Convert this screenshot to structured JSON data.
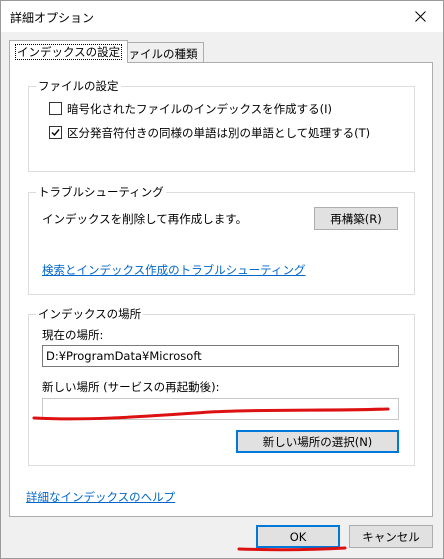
{
  "window": {
    "title": "詳細オプション"
  },
  "tabs": [
    {
      "label": "インデックスの設定"
    },
    {
      "label": "ファイルの種類"
    }
  ],
  "file_settings": {
    "label": "ファイルの設定",
    "option_encrypted": {
      "label": "暗号化されたファイルのインデックスを作成する(I)",
      "checked": false
    },
    "option_diacritics": {
      "label": "区分発音符付きの同様の単語は別の単語として処理する(T)",
      "checked": true
    }
  },
  "troubleshooting": {
    "label": "トラブルシューティング",
    "description": "インデックスを削除して再作成します。",
    "rebuild_button": "再構築(R)",
    "link": "検索とインデックス作成のトラブルシューティング"
  },
  "index_location": {
    "label": "インデックスの場所",
    "current_label": "現在の場所:",
    "current_value": "D:¥ProgramData¥Microsoft",
    "new_label": "新しい場所 (サービスの再起動後):",
    "new_value": "",
    "select_button": "新しい場所の選択(N)"
  },
  "help_link": "詳細なインデックスのヘルプ",
  "footer": {
    "ok_label": "OK",
    "cancel_label": "キャンセル"
  },
  "colors": {
    "annotation": "#dd1111",
    "link": "#0066cc",
    "focus": "#0078d7"
  }
}
